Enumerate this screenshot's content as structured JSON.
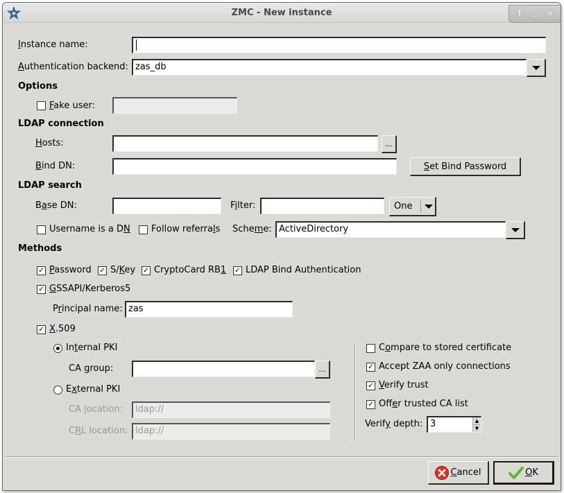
{
  "window": {
    "title": "ZMC - New instance",
    "icon": "zmc-star-icon",
    "controls": [
      "shade-up",
      "maximize",
      "close"
    ],
    "controls_glyphs": {
      "shade": "🡑",
      "maximize": "☐",
      "close": "✕"
    }
  },
  "general": {
    "instance_name": {
      "label_pre": "",
      "mnemonic": "I",
      "label_post": "nstance name:",
      "value": ""
    },
    "auth_backend": {
      "label_pre": "",
      "mnemonic": "A",
      "label_post": "uthentication backend:",
      "value": "zas_db"
    }
  },
  "options": {
    "header": "Options",
    "fake_user": {
      "label_pre": "",
      "mnemonic": "F",
      "label_post": "ake user:",
      "checked": false,
      "value": ""
    }
  },
  "ldap_connection": {
    "header": "LDAP connection",
    "hosts": {
      "label_pre": "",
      "mnemonic": "H",
      "label_post": "osts:",
      "value": "",
      "browse_label": "..."
    },
    "bind_dn": {
      "label_pre": "",
      "mnemonic": "B",
      "label_post": "ind DN:",
      "value": ""
    },
    "set_bind_password": {
      "label_pre": "",
      "mnemonic": "S",
      "label_post": "et Bind Password"
    }
  },
  "ldap_search": {
    "header": "LDAP search",
    "base_dn": {
      "label_pre": "B",
      "mnemonic": "a",
      "label_post": "se DN:",
      "value": ""
    },
    "filter": {
      "label_pre": "F",
      "mnemonic": "i",
      "label_post": "lter:",
      "value": ""
    },
    "scope": {
      "value": "One"
    },
    "username_is_dn": {
      "label_pre": "Username is a D",
      "mnemonic": "N",
      "label_post": "",
      "checked": false
    },
    "follow_referrals": {
      "label_pre": "Follow referra",
      "mnemonic": "l",
      "label_post": "s",
      "checked": false
    },
    "scheme": {
      "label_pre": "Sche",
      "mnemonic": "m",
      "label_post": "e:",
      "value": "ActiveDirectory"
    }
  },
  "methods": {
    "header": "Methods",
    "password": {
      "label_pre": "",
      "mnemonic": "P",
      "label_post": "assword",
      "checked": true
    },
    "skey": {
      "label_pre": "S/",
      "mnemonic": "K",
      "label_post": "ey",
      "checked": true
    },
    "cryptocard": {
      "label_pre": "CryptoCard RB",
      "mnemonic": "1",
      "label_post": "",
      "checked": true
    },
    "ldap_bind": {
      "label_pre": "LDAP Bind Authentication",
      "mnemonic": "",
      "label_post": "",
      "checked": true
    },
    "gssapi": {
      "label_pre": "",
      "mnemonic": "G",
      "label_post": "SSAPI/Kerberos5",
      "checked": true
    },
    "principal_name": {
      "label_pre": "P",
      "mnemonic": "r",
      "label_post": "incipal name:",
      "value": "zas"
    },
    "x509": {
      "label_pre": "",
      "mnemonic": "X",
      "label_post": ".509",
      "checked": true
    }
  },
  "x509": {
    "internal_pki": {
      "label_pre": "In",
      "mnemonic": "t",
      "label_post": "ernal PKI",
      "selected": true
    },
    "ca_group": {
      "label_pre": "CA ",
      "mnemonic": "g",
      "label_post": "roup:",
      "value": "",
      "browse_label": "..."
    },
    "external_pki": {
      "label_pre": "E",
      "mnemonic": "x",
      "label_post": "ternal PKI",
      "selected": false
    },
    "ca_location": {
      "label_pre": "CA ",
      "mnemonic": "l",
      "label_post": "ocation:",
      "value": "ldap://"
    },
    "crl_location": {
      "label_pre": "C",
      "mnemonic": "R",
      "label_post": "L location:",
      "value": "ldap://"
    },
    "compare_stored": {
      "label_pre": "C",
      "mnemonic": "o",
      "label_post": "mpare to stored certificate",
      "checked": false
    },
    "accept_zaa": {
      "label_pre": "Accept ZAA only connections",
      "mnemonic": "",
      "label_post": "",
      "checked": true
    },
    "verify_trust": {
      "label_pre": "",
      "mnemonic": "V",
      "label_post": "erify trust",
      "checked": true
    },
    "offer_ca_list": {
      "label_pre": "Off",
      "mnemonic": "e",
      "label_post": "r trusted CA list",
      "checked": true
    },
    "verify_depth": {
      "label_pre": "Verif",
      "mnemonic": "y",
      "label_post": " depth:",
      "value": "3"
    }
  },
  "buttons": {
    "cancel": {
      "label_pre": "",
      "mnemonic": "C",
      "label_post": "ancel"
    },
    "ok": {
      "label_pre": "",
      "mnemonic": "O",
      "label_post": "K"
    }
  },
  "colors": {
    "window_bg": "#dcdad5",
    "cancel_icon": "#d9312c",
    "ok_icon": "#5cb82a"
  }
}
